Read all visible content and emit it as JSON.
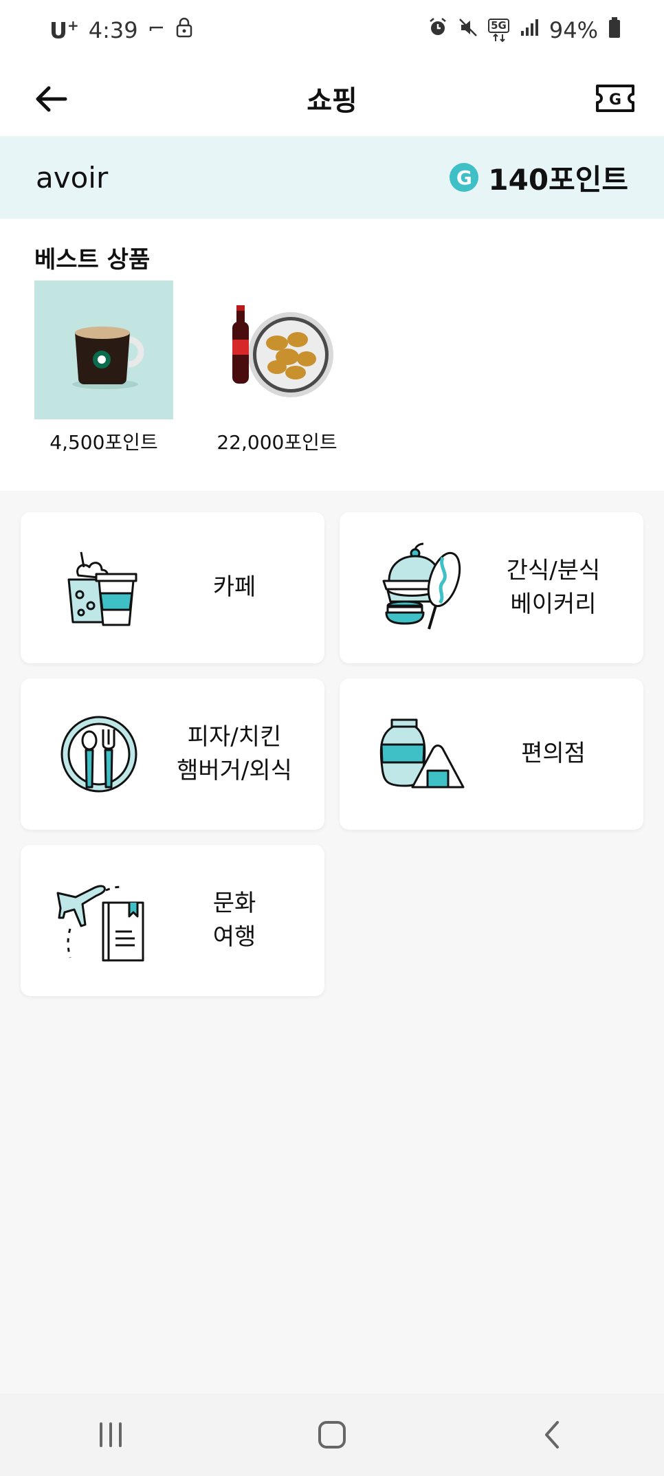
{
  "status_bar": {
    "carrier": "U",
    "carrier_plus": "+",
    "time": "4:39",
    "network": "5G",
    "battery": "94%",
    "icons": [
      "minus-icon",
      "lock-icon",
      "alarm-icon",
      "mute-icon",
      "network-5g-icon",
      "signal-icon",
      "battery-icon"
    ]
  },
  "header": {
    "title": "쇼핑",
    "back_icon": "arrow-left-icon",
    "voucher_icon": "g-ticket-icon"
  },
  "points_bar": {
    "username": "avoir",
    "badge": "G",
    "points": "140포인트"
  },
  "best_products": {
    "title": "베스트 상품",
    "items": [
      {
        "price": "4,500포인트",
        "image": "coffee-mug"
      },
      {
        "price": "22,000포인트",
        "image": "chicken-and-cola"
      }
    ]
  },
  "categories": [
    {
      "label": "카페",
      "icon": "cafe-icon"
    },
    {
      "label": "간식/분식\n베이커리",
      "icon": "snack-bakery-icon"
    },
    {
      "label": "피자/치킨\n햄버거/외식",
      "icon": "dining-icon"
    },
    {
      "label": "편의점",
      "icon": "convenience-store-icon"
    },
    {
      "label": "문화\n여행",
      "icon": "culture-travel-icon"
    }
  ],
  "nav_bar": {
    "buttons": [
      "recent-apps-icon",
      "home-icon",
      "back-icon"
    ]
  },
  "colors": {
    "accent": "#3fbfc6",
    "points_bg": "#e8f5f7",
    "page_bg": "#f7f7f7"
  }
}
